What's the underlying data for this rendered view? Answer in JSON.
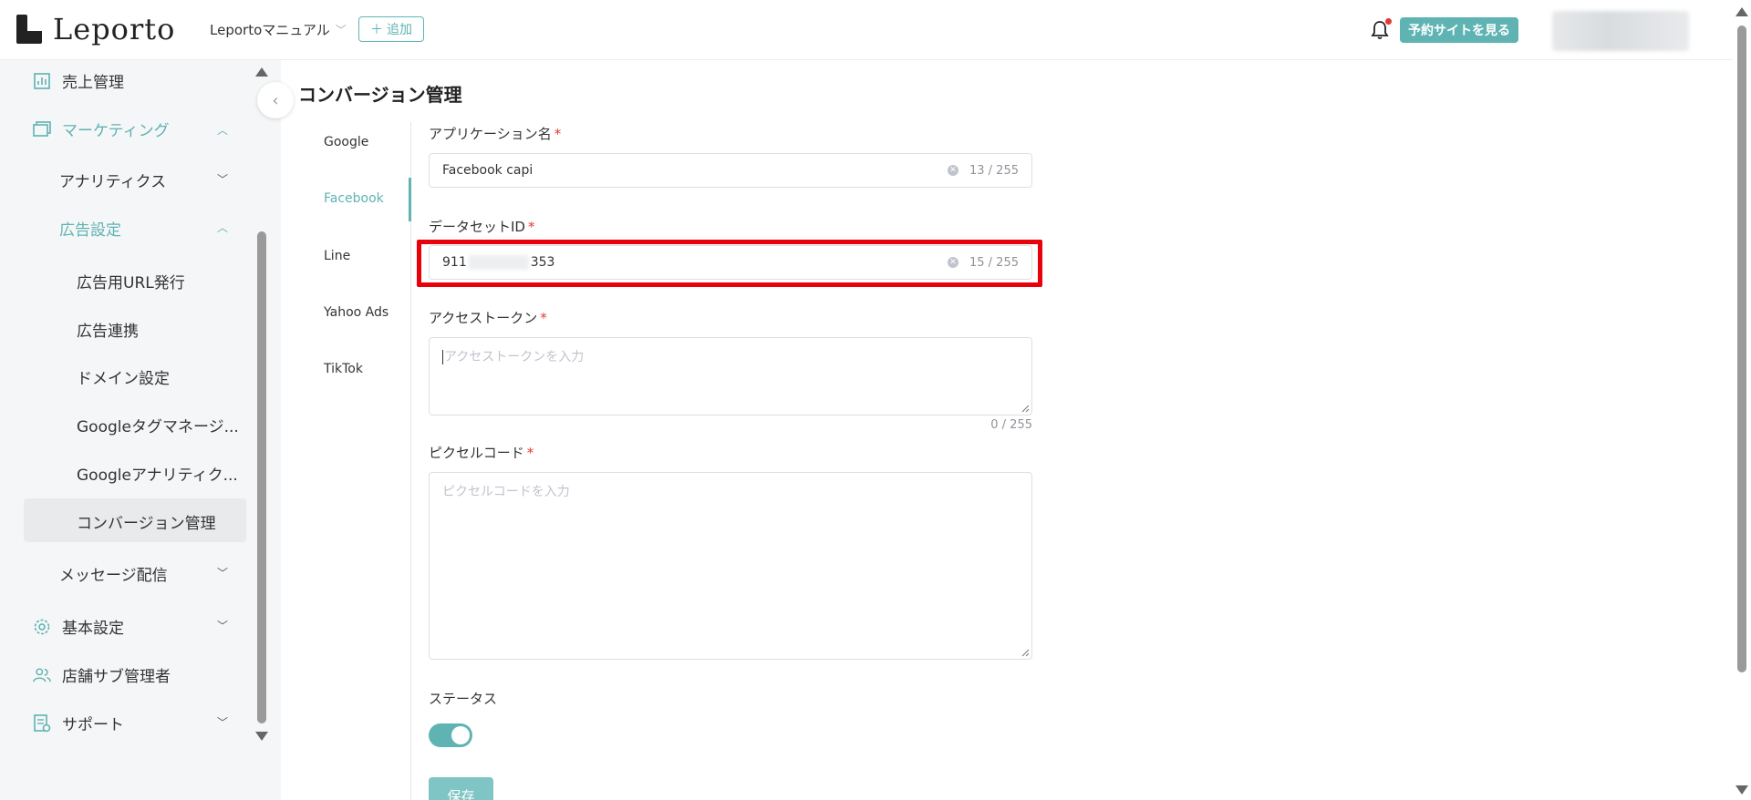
{
  "header": {
    "logo_text": "Leporto",
    "store_name": "Leportoマニュアル",
    "add_label": "追加",
    "reserve_site_label": "予約サイトを見る"
  },
  "sidebar": {
    "sales": "売上管理",
    "marketing": "マーケティング",
    "analytics": "アナリティクス",
    "ad_settings": "広告設定",
    "ad_url": "広告用URL発行",
    "ad_link": "広告連携",
    "domain": "ドメイン設定",
    "gtm": "Googleタグマネージ...",
    "ga": "Googleアナリティク...",
    "conversion": "コンバージョン管理",
    "message": "メッセージ配信",
    "basic": "基本設定",
    "sub_admin": "店舗サブ管理者",
    "support": "サポート"
  },
  "page": {
    "title": "コンバージョン管理"
  },
  "tabs": [
    "Google",
    "Facebook",
    "Line",
    "Yahoo Ads",
    "TikTok"
  ],
  "form": {
    "app_name_label": "アプリケーション名",
    "app_name_value": "Facebook capi",
    "app_name_count": "13 / 255",
    "dataset_label": "データセットID",
    "dataset_value_start": "911",
    "dataset_value_end": "353",
    "dataset_count": "15 / 255",
    "token_label": "アクセストークン",
    "token_placeholder": "アクセストークンを入力",
    "token_count": "0 / 255",
    "pixel_label": "ピクセルコード",
    "pixel_placeholder": "ピクセルコードを入力",
    "status_label": "ステータス",
    "status_on": true,
    "save_label": "保存"
  },
  "colors": {
    "accent": "#5fb3b3",
    "highlight": "#e8000b"
  }
}
